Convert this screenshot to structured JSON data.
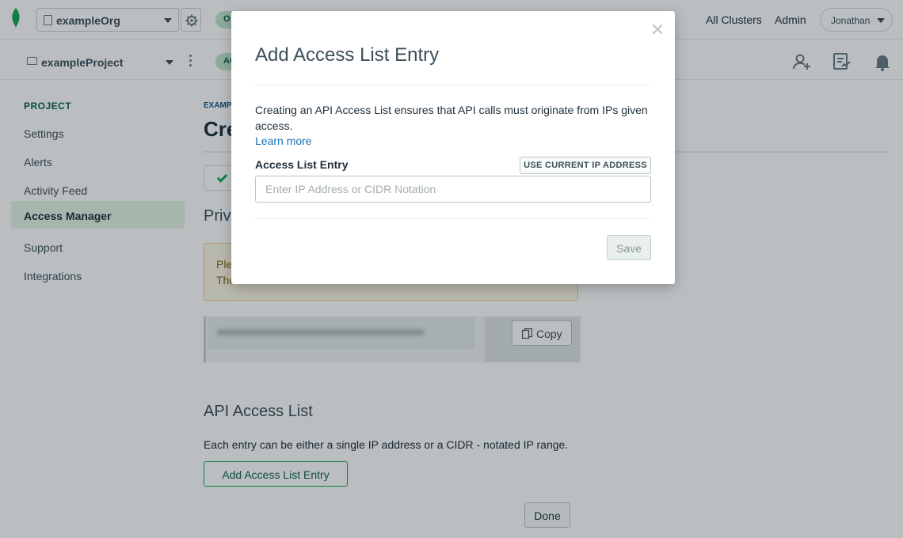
{
  "topbar": {
    "org_name": "exampleOrg",
    "org_badge": "O",
    "links": [
      "All Clusters",
      "Admin"
    ],
    "user_name": "Jonathan"
  },
  "projectbar": {
    "project_name": "exampleProject",
    "project_badge": "AC"
  },
  "sidebar": {
    "heading": "PROJECT",
    "items": [
      {
        "label": "Settings"
      },
      {
        "label": "Alerts"
      },
      {
        "label": "Activity Feed"
      },
      {
        "label": "Access Manager",
        "active": true
      },
      {
        "label": "Support"
      },
      {
        "label": "Integrations"
      }
    ]
  },
  "main": {
    "breadcrumb": "EXAMP",
    "title": "Cre",
    "private_heading": "Priva",
    "warning_line1": "Ple",
    "warning_line2": "The",
    "copy_label": "Copy",
    "api_heading": "API Access List",
    "api_description": "Each entry can be either a single IP address or a CIDR - notated IP range.",
    "add_entry_label": "Add Access List Entry",
    "done_label": "Done"
  },
  "modal": {
    "title": "Add Access List Entry",
    "description": "Creating an API Access List ensures that API calls must originate from IPs given access.",
    "learn_more": "Learn more",
    "entry_label": "Access List Entry",
    "use_ip_label": "USE CURRENT IP ADDRESS",
    "input_placeholder": "Enter IP Address or CIDR Notation",
    "input_value": "",
    "save_label": "Save"
  },
  "colors": {
    "brand_green": "#13aa52",
    "dark_green": "#116149",
    "link_blue": "#1a73b7",
    "active_bg": "#e4f4e4"
  },
  "icons": [
    "leaf-logo-icon",
    "building-icon",
    "gear-icon",
    "folder-icon",
    "kebab-icon",
    "add-user-icon",
    "activity-icon",
    "bell-icon",
    "check-icon",
    "copy-icon",
    "close-icon"
  ]
}
